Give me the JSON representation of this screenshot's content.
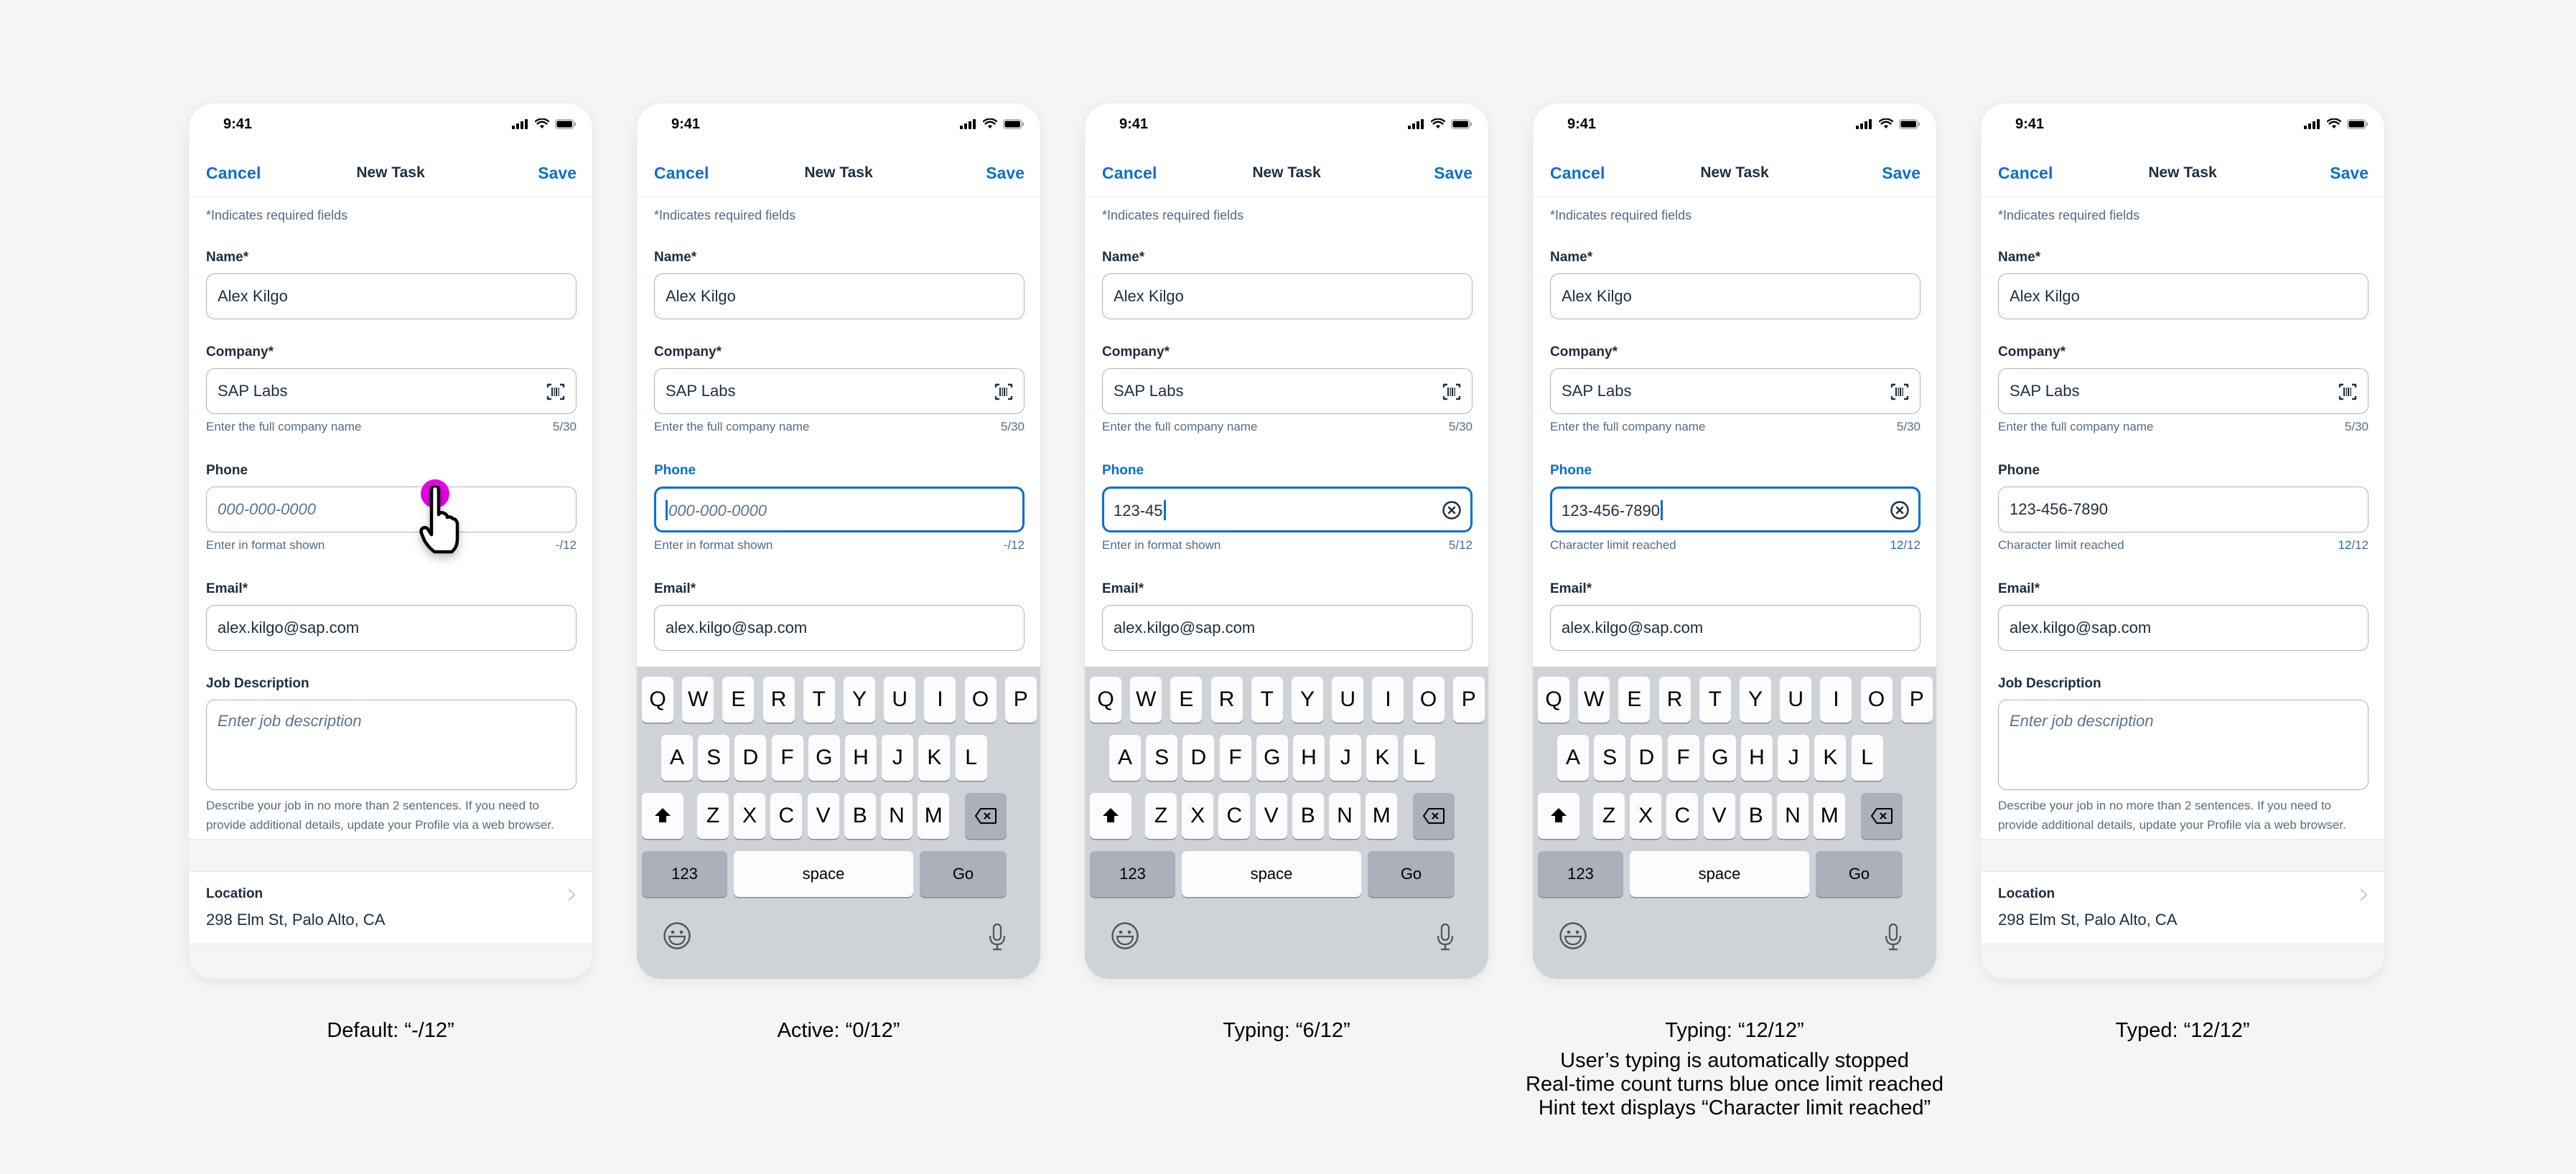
{
  "colors": {
    "accent": "#0a6ed1",
    "text": "#1d2d3e",
    "hint": "#556b82",
    "background": "#f4f5f7",
    "touch_indicator": "#e600e6"
  },
  "common": {
    "status_time": "9:41",
    "status_icons": [
      "signal-icon",
      "wifi-icon",
      "battery-icon"
    ],
    "nav": {
      "cancel": "Cancel",
      "title": "New Task",
      "save": "Save"
    },
    "required_note": "*Indicates required fields",
    "name": {
      "label": "Name*",
      "value": "Alex Kilgo"
    },
    "company": {
      "label": "Company*",
      "value": "SAP Labs",
      "icon": "barcode-scan-icon",
      "hint": "Enter the full company name",
      "counter": "5/30"
    },
    "phone": {
      "label": "Phone",
      "placeholder": "000-000-0000"
    },
    "email": {
      "label": "Email*",
      "value": "alex.kilgo@sap.com"
    },
    "job": {
      "label": "Job Description",
      "placeholder": "Enter job description",
      "hint": "Describe your job in no more than 2 sentences. If you need to provide additional details, update your Profile via a web browser."
    },
    "location": {
      "label": "Location",
      "value": "298 Elm St, Palo Alto, CA"
    }
  },
  "keyboard": {
    "row1": [
      "Q",
      "W",
      "E",
      "R",
      "T",
      "Y",
      "U",
      "I",
      "O",
      "P"
    ],
    "row2": [
      "A",
      "S",
      "D",
      "F",
      "G",
      "H",
      "J",
      "K",
      "L"
    ],
    "row3": [
      "Z",
      "X",
      "C",
      "V",
      "B",
      "N",
      "M"
    ],
    "numbers": "123",
    "space": "space",
    "go": "Go"
  },
  "screens": [
    {
      "state": "default",
      "caption": "Default: “-/12”",
      "phone_value": "",
      "phone_hint": "Enter in format shown",
      "phone_counter_count": "-",
      "phone_counter_max": "/12",
      "focused": false,
      "keyboard": false
    },
    {
      "state": "active",
      "caption": "Active: “0/12”",
      "phone_value": "",
      "phone_hint": "Enter in format shown",
      "phone_counter_count": "-",
      "phone_counter_max": "/12",
      "focused": true,
      "keyboard": true
    },
    {
      "state": "typing",
      "caption": "Typing: “6/12”",
      "phone_value": "123-45",
      "phone_hint": "Enter in format shown",
      "phone_counter_count": "5",
      "phone_counter_max": "/12",
      "focused": true,
      "keyboard": true
    },
    {
      "state": "typing-limit",
      "caption": "Typing: “12/12”",
      "caption_notes": [
        "User’s typing is automatically stopped",
        "Real-time count turns blue once limit reached",
        "Hint text displays “Character limit reached”"
      ],
      "phone_value": "123-456-7890",
      "phone_hint": "Character limit reached",
      "phone_counter_count": "12",
      "phone_counter_max": "/12",
      "focused": true,
      "keyboard": true
    },
    {
      "state": "typed",
      "caption": "Typed: “12/12”",
      "phone_value": "123-456-7890",
      "phone_hint": "Character limit reached",
      "phone_counter_count": "12",
      "phone_counter_max": "/12",
      "focused": false,
      "keyboard": false
    }
  ]
}
